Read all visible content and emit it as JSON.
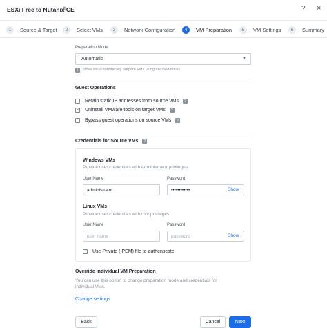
{
  "header": {
    "title": "ESXi Free to Nutanix CE",
    "help": "?",
    "close": "×"
  },
  "steps": [
    {
      "num": "1",
      "label": "Source & Target"
    },
    {
      "num": "2",
      "label": "Select VMs"
    },
    {
      "num": "3",
      "label": "Network Configuration"
    },
    {
      "num": "4",
      "label": "VM Preparation"
    },
    {
      "num": "5",
      "label": "VM Settings"
    },
    {
      "num": "6",
      "label": "Summary"
    }
  ],
  "prep_mode": {
    "label": "Preparation Mode",
    "value": "Automatic",
    "hint": "Move will automatically prepare VMs using the credentials."
  },
  "guest_ops": {
    "title": "Guest Operations",
    "options": [
      {
        "label": "Retain static IP addresses from source VMs",
        "checked": false
      },
      {
        "label": "Uninstall VMware tools on target VMs",
        "checked": true
      },
      {
        "label": "Bypass guest operations on source VMs",
        "checked": false
      }
    ]
  },
  "credentials": {
    "title": "Credentials for Source VMs",
    "windows": {
      "title": "Windows VMs",
      "subtitle": "Provide user credentials with Administrator privileges.",
      "user_label": "User Name",
      "user_value": "administrator",
      "pass_label": "Password",
      "pass_value": "••••••••••••",
      "show": "Show"
    },
    "linux": {
      "title": "Linux VMs",
      "subtitle": "Provide user credentials with root privileges.",
      "user_label": "User Name",
      "user_placeholder": "user name",
      "pass_label": "Password",
      "pass_placeholder": "password",
      "show": "Show",
      "pem_label": "Use Private (.PEM) file to authenticate",
      "pem_checked": false
    }
  },
  "override": {
    "title": "Override individual VM Preparation",
    "desc_line1": "You can use this option to change preparation mode and credentials for",
    "desc_line2": "individual VMs.",
    "link": "Change settings"
  },
  "footer": {
    "back": "Back",
    "cancel": "Cancel",
    "next": "Next"
  },
  "colors": {
    "accent": "#1b6ce5"
  }
}
